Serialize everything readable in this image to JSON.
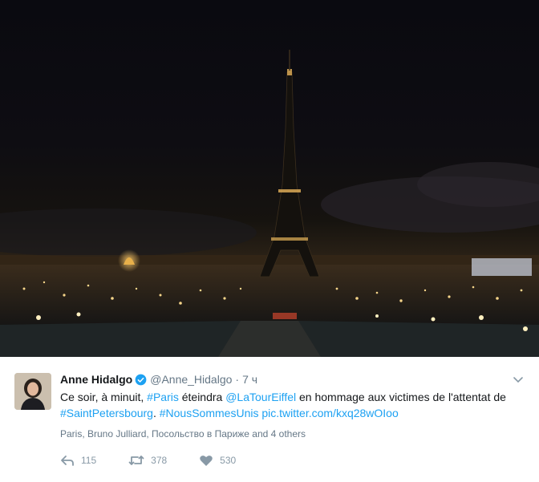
{
  "photo": {
    "subject": "Eiffel Tower at night with lights off"
  },
  "tweet": {
    "author_name": "Anne Hidalgo",
    "author_handle": "@Anne_Hidalgo",
    "separator": "·",
    "time": "7 ч",
    "text": {
      "part1": "Ce soir, à minuit, ",
      "hashtag_paris": "#Paris",
      "part2": " éteindra ",
      "mention": "@LaTourEiffel",
      "part3": " en hommage aux victimes de l'attentat de ",
      "hashtag_stpetersbourg": "#SaintPetersbourg",
      "part4": ". ",
      "hashtag_nous": "#NousSommesUnis",
      "part5": " ",
      "pic_link": "pic.twitter.com/kxq28wOIoo"
    },
    "tagged": "Paris, Bruno Julliard, Посольство в Париже and 4 others",
    "replies": "115",
    "retweets": "378",
    "likes": "530"
  },
  "colors": {
    "link": "#1da1f2",
    "meta": "#657786",
    "action": "#8899a6"
  },
  "icons": [
    "verified-badge-icon",
    "chevron-down-icon",
    "reply-icon",
    "retweet-icon",
    "like-icon"
  ]
}
